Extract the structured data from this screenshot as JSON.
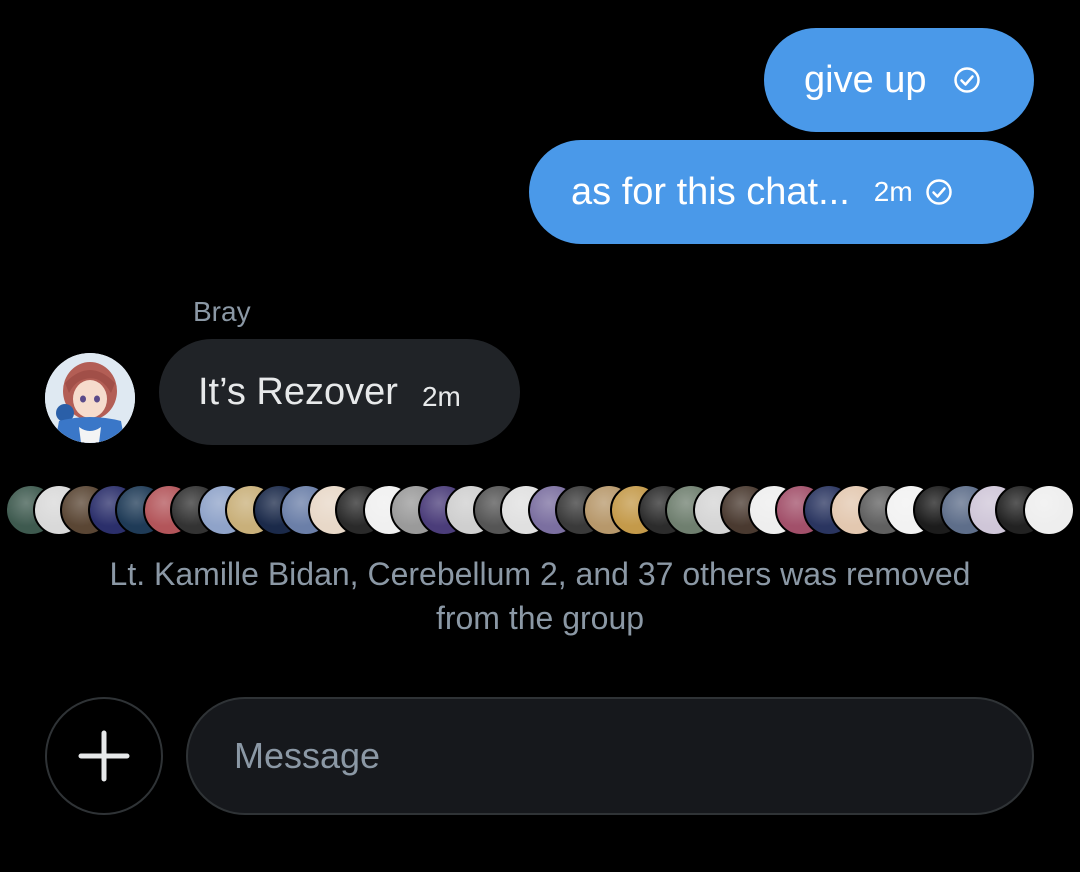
{
  "messages_outgoing": [
    {
      "text": "give up",
      "time": "",
      "status_icon": "sent-check-icon"
    },
    {
      "text": "as for this chat...",
      "time": "2m",
      "status_icon": "sent-check-icon"
    }
  ],
  "message_incoming": {
    "sender": "Bray",
    "text": "It’s Rezover",
    "time": "2m",
    "avatar_icon": "user-avatar"
  },
  "system_event": {
    "line1": "Lt. Kamille Bidan, Cerebellum 2, and 37 others was removed",
    "line2": "from the group",
    "removed_avatar_colors": [
      "#3e5a4f",
      "#d9d9d9",
      "#5a4634",
      "#2b2f6b",
      "#1f3b57",
      "#b3555a",
      "#333333",
      "#8fa3c9",
      "#c9b07a",
      "#1b2a4a",
      "#6b7fa8",
      "#e8d8c8",
      "#2a2a2a",
      "#f0f0f0",
      "#9a9a9a",
      "#4b3d7a",
      "#cfcfcf",
      "#555555",
      "#e0e0e0",
      "#7b6fa0",
      "#3a3a3a",
      "#b7986b",
      "#c49a4a",
      "#2c2c2c",
      "#6f7f6f",
      "#d5d5d5",
      "#4a3a30",
      "#eeeeee",
      "#a2506a",
      "#2a3560",
      "#e3c8b0",
      "#606060",
      "#f2f2f2",
      "#1c1c1c",
      "#5e6e8a",
      "#cfc6d8",
      "#222222",
      "#eeeeee"
    ]
  },
  "composer": {
    "add_label": "+",
    "placeholder": "Message"
  },
  "colors": {
    "outgoing_bubble": "#4a99e9",
    "incoming_bubble": "#202327",
    "muted_text": "#8b98a5",
    "background": "#000000"
  }
}
